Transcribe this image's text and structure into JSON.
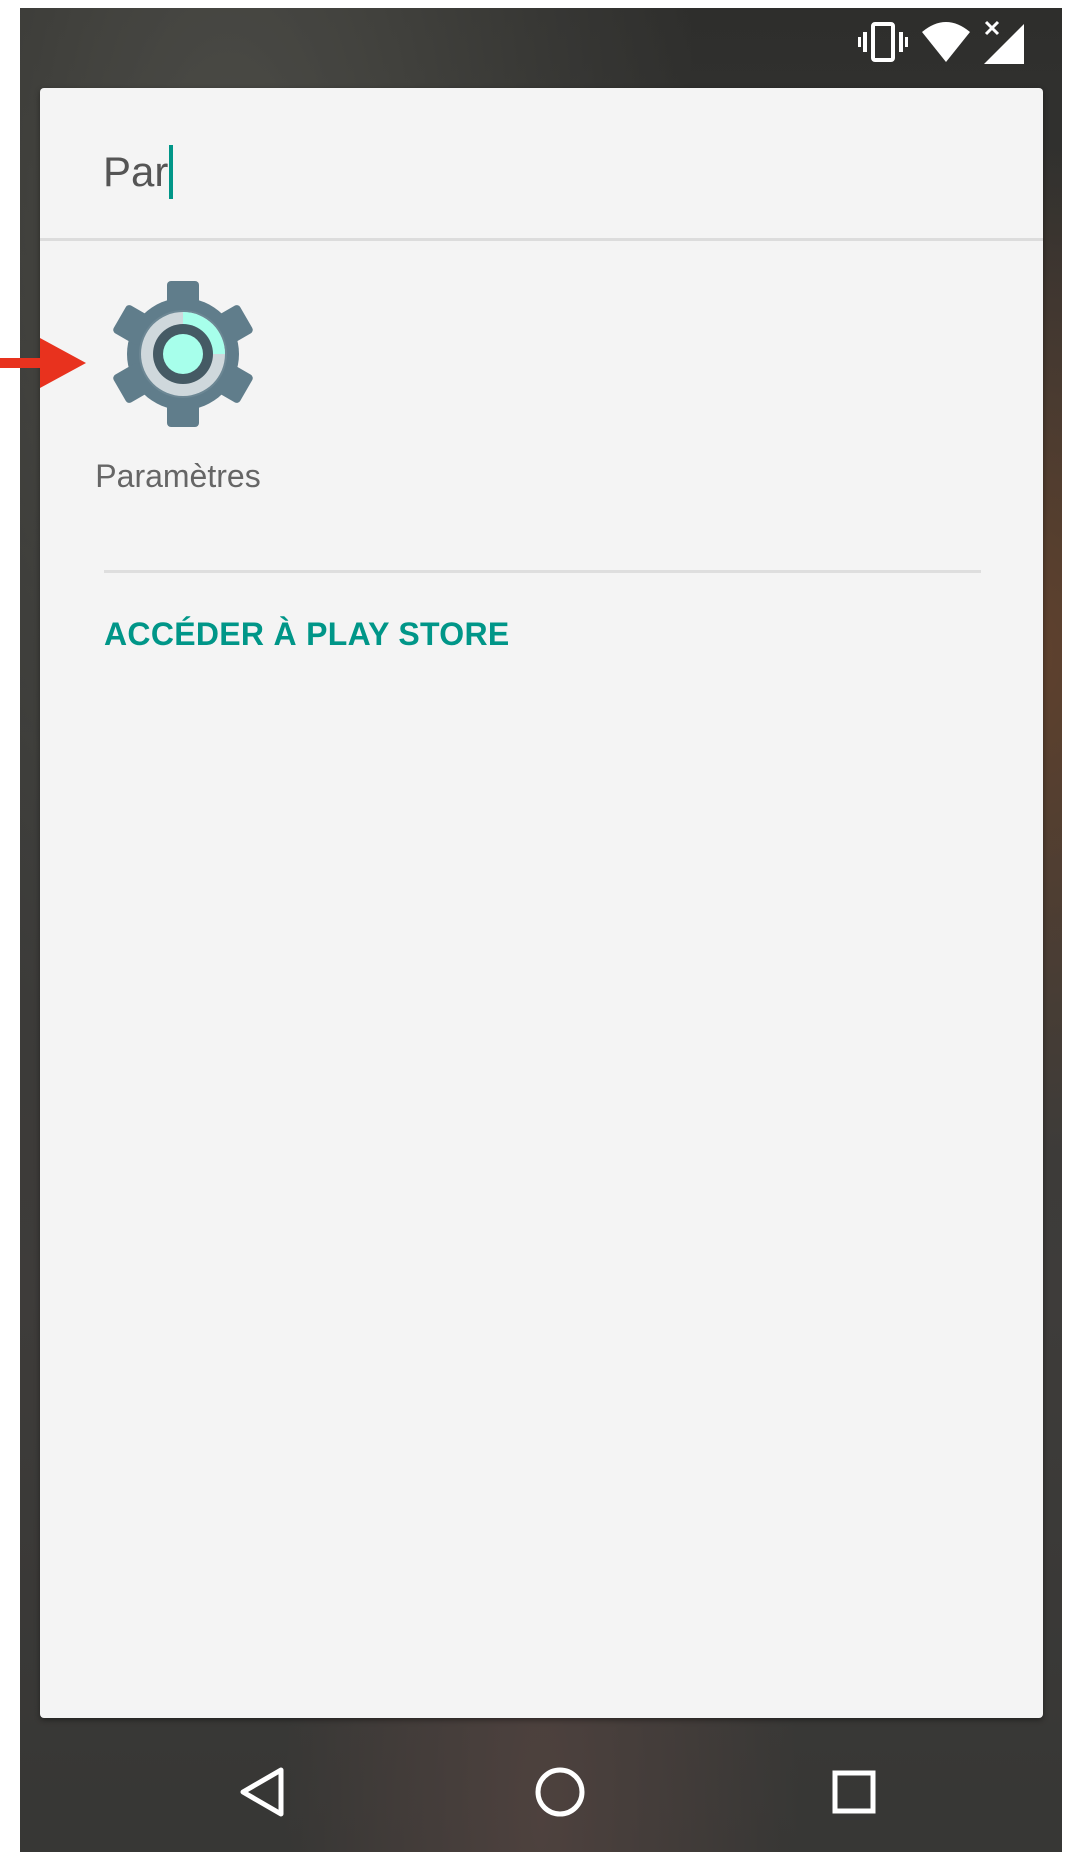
{
  "status_bar": {
    "icons": [
      "vibrate-icon",
      "wifi-icon",
      "signal-no-data-icon"
    ]
  },
  "search": {
    "query": "Par",
    "cursor_color": "#009688"
  },
  "results": {
    "apps": [
      {
        "label": "Paramètres",
        "icon": "settings-gear-icon"
      }
    ]
  },
  "play_store_link": {
    "label": "ACCÉDER À PLAY STORE",
    "color": "#009688"
  },
  "nav_bar": {
    "buttons": [
      "back-icon",
      "home-icon",
      "recents-icon"
    ]
  },
  "annotation": {
    "arrow_color": "#e8321e"
  }
}
